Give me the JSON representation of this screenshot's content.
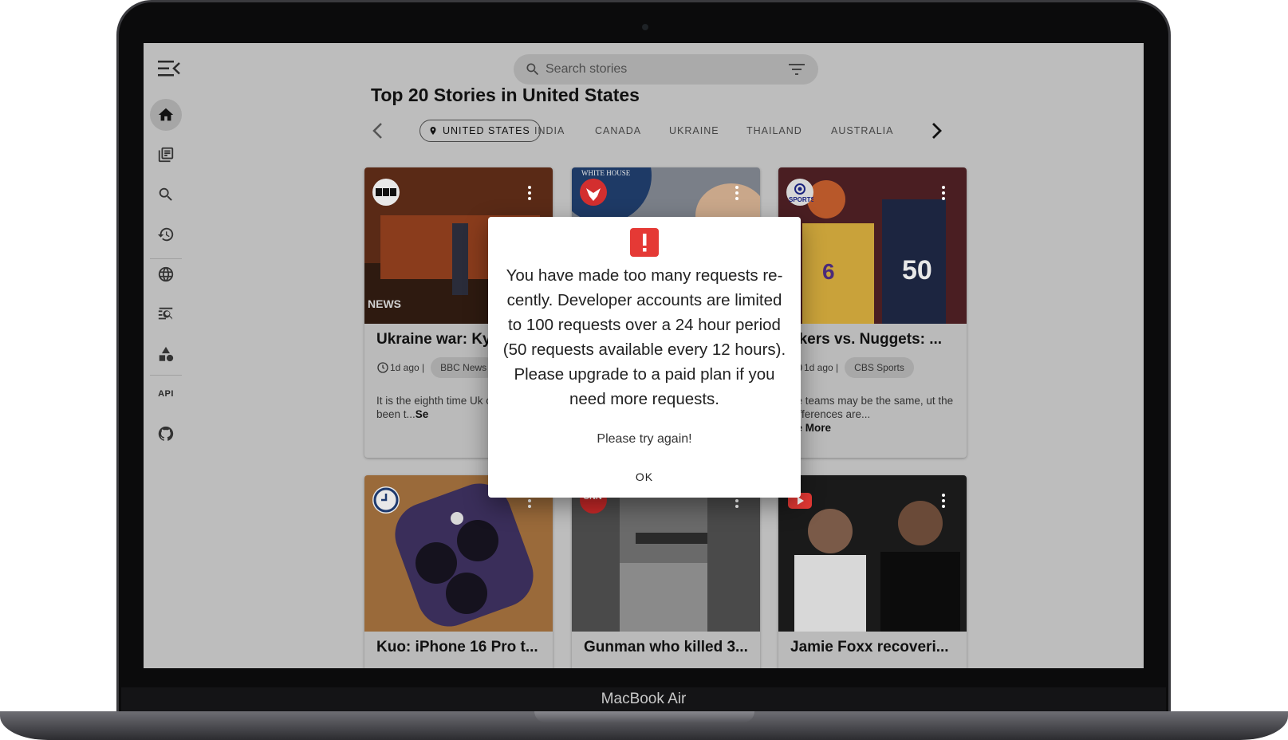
{
  "device_label": "MacBook Air",
  "search": {
    "placeholder": "Search stories"
  },
  "page_title": "Top 20 Stories in United States",
  "tabs": [
    {
      "label": "UNITED STATES",
      "active": true
    },
    {
      "label": "INDIA"
    },
    {
      "label": "CANADA"
    },
    {
      "label": "UKRAINE"
    },
    {
      "label": "THAILAND"
    },
    {
      "label": "AUSTRALIA"
    }
  ],
  "sidebar": {
    "items": [
      "home-icon",
      "newspaper-icon",
      "search-icon",
      "history-icon",
      "globe-icon",
      "source-search-icon",
      "categories-icon",
      "api-icon",
      "github-icon"
    ],
    "api_label": "API"
  },
  "cards": [
    {
      "title": "Ukraine war: Ky",
      "time": "1d ago |",
      "source": "BBC News",
      "desc": "It is the eighth time Uk capital has been t...",
      "more": "Se",
      "logo_text": "NEWS"
    },
    {
      "title": "",
      "time": "",
      "source": "",
      "desc": "",
      "logo_text": "WHITE HOUSE"
    },
    {
      "title": "akers vs. Nuggets: ...",
      "time": "1d ago |",
      "source": "CBS Sports",
      "desc": "he teams may be the same, ut the differences are...",
      "more": "ee More",
      "logo_text": "SPORTS"
    },
    {
      "title": "Kuo: iPhone 16 Pro t..."
    },
    {
      "title": "Gunman who killed 3...",
      "logo_text": "CNN"
    },
    {
      "title": "Jamie Foxx recoveri..."
    }
  ],
  "dialog": {
    "message": "You have made too many requests re-cently. Developer accounts are limited to 100 requests over a 24 hour period (50 requests available every 12 hours). Please upgrade to a paid plan if you need more requests.",
    "retry": "Please try again!",
    "ok_label": "OK"
  },
  "colors": {
    "error": "#e53935",
    "screen_dim": "#bdbdbd"
  }
}
